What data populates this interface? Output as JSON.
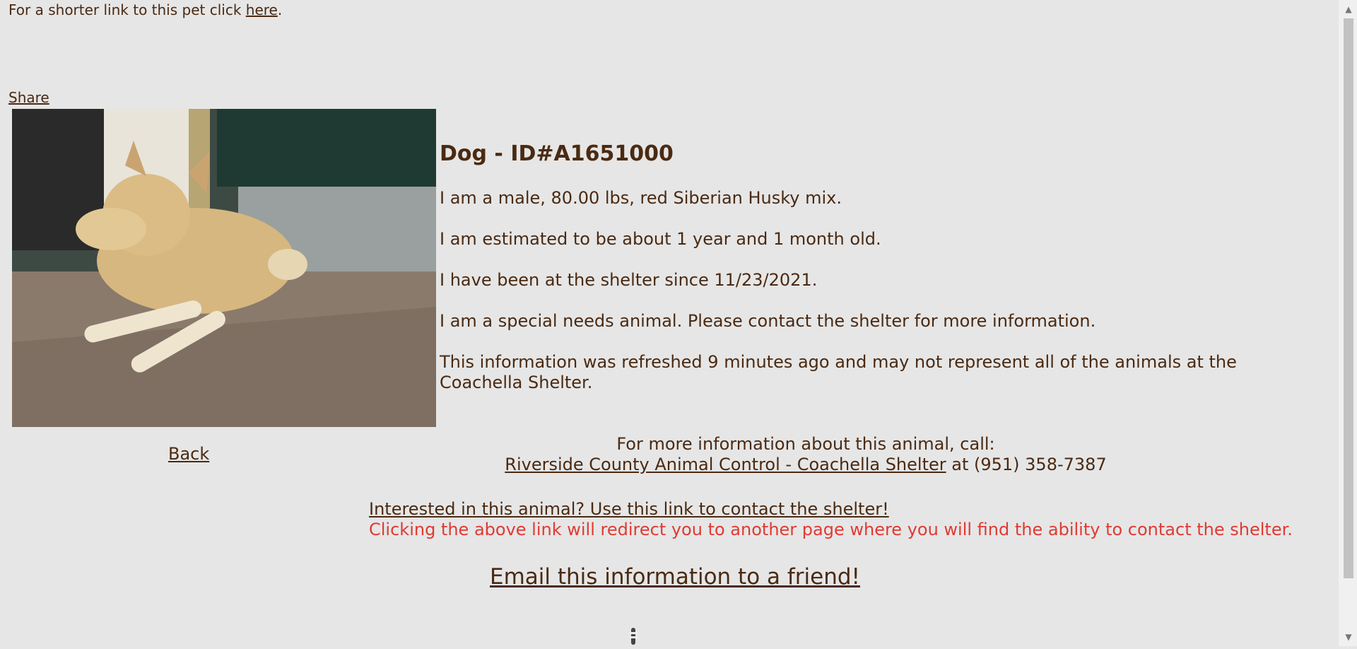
{
  "top_note": {
    "text": "For a shorter link to this pet click ",
    "link": "here",
    "suffix": "."
  },
  "share_label": "Share",
  "pet": {
    "heading": "Dog - ID#A1651000",
    "description": "I am a male, 80.00 lbs, red Siberian Husky mix.",
    "age": "I am estimated to be about 1 year and 1 month old.",
    "since": "I have been at the shelter since 11/23/2021.",
    "special_needs": "I am a special needs animal. Please contact the shelter for more information.",
    "refreshed": "This information was refreshed 9 minutes ago and may not represent all of the animals at the Coachella Shelter."
  },
  "back_label": "Back",
  "contact": {
    "call_text": "For more information about this animal, call:",
    "shelter_link": "Riverside County Animal Control - Coachella Shelter",
    "phone_text": " at (951) 358-7387"
  },
  "interested": {
    "link": "Interested in this animal? Use this link to contact the shelter!",
    "warning": "Clicking the above link will redirect you to another page where you will find the ability to contact the shelter."
  },
  "email_label": "Email this information to a friend!",
  "icons": {
    "scroll_up": "scroll-up-arrow-icon",
    "scroll_down": "scroll-down-arrow-icon",
    "loading": "loading-spinner-icon"
  }
}
